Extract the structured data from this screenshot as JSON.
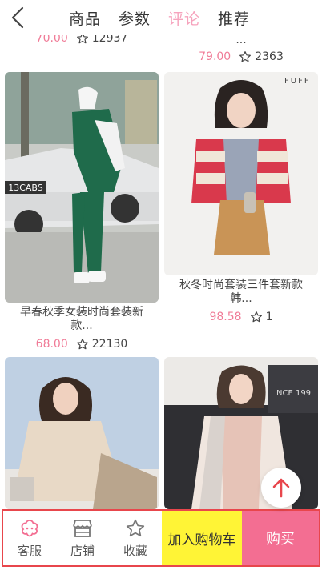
{
  "header": {
    "tabs": [
      {
        "label": "商品"
      },
      {
        "label": "参数"
      },
      {
        "label": "评论"
      },
      {
        "label": "推荐"
      }
    ],
    "active_tab": 2
  },
  "products": [
    {
      "title_line1": "",
      "title_line2": "",
      "price": "70.00",
      "count": "12937"
    },
    {
      "title_line1": "",
      "title_line2": "...",
      "price": "79.00",
      "count": "2363"
    },
    {
      "title_line1": "早春秋季女装时尚套装新",
      "title_line2": "款...",
      "price": "68.00",
      "count": "22130"
    },
    {
      "title_line1": "秋冬时尚套装三件套新款",
      "title_line2": "韩...",
      "price": "98.58",
      "count": "1"
    },
    {
      "title_line1": "",
      "title_line2": "",
      "price": "",
      "count": ""
    },
    {
      "title_line1": "",
      "title_line2": "",
      "price": "",
      "count": ""
    }
  ],
  "image_text": {
    "plate": "13CABS",
    "brand": "FUFF",
    "sign": "NCE 199"
  },
  "bottom_bar": {
    "service_label": "客服",
    "store_label": "店铺",
    "favorite_label": "收藏",
    "cart_label": "加入购物车",
    "buy_label": "购买"
  },
  "colors": {
    "accent_pink": "#f6a3bd",
    "price_pink": "#f07b97",
    "buy_pink": "#f36e92",
    "cart_yellow": "#fff436",
    "bar_border_red": "#e8464c"
  }
}
